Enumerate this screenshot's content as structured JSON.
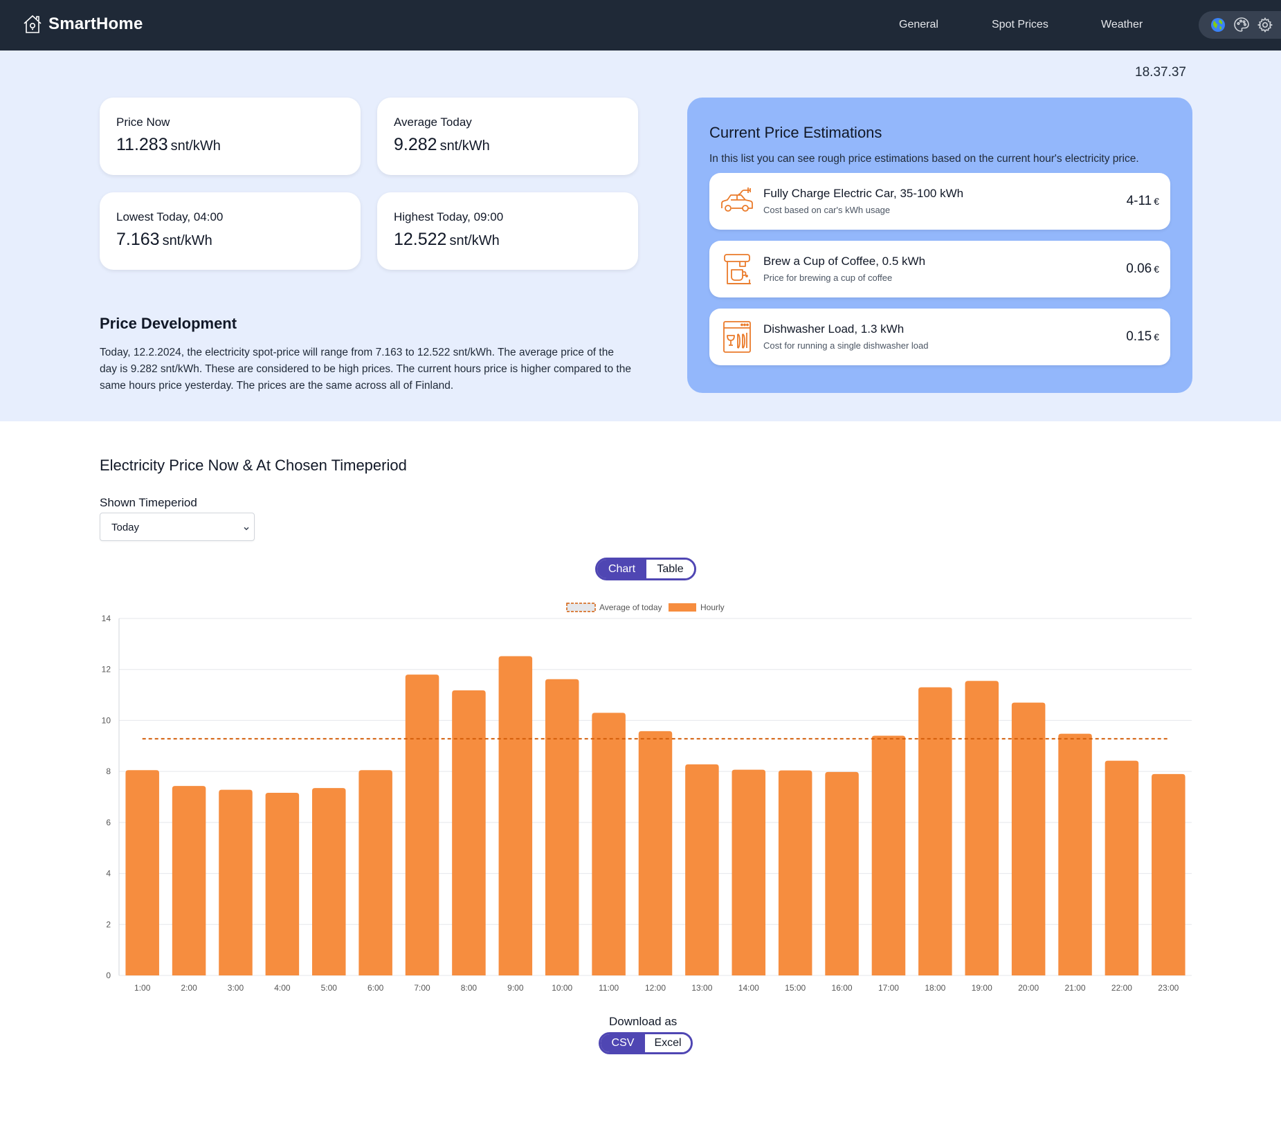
{
  "header": {
    "brand": "SmartHome",
    "nav": [
      {
        "label": "General"
      },
      {
        "label": "Spot Prices"
      },
      {
        "label": "Weather"
      }
    ],
    "icons": [
      "globe-icon",
      "palette-icon",
      "gear-icon"
    ]
  },
  "clock": "18.37.37",
  "stats": {
    "price_now": {
      "label": "Price Now",
      "value": "11.283",
      "unit": "snt/kWh"
    },
    "average_today": {
      "label": "Average Today",
      "value": "9.282",
      "unit": "snt/kWh"
    },
    "lowest_today": {
      "label": "Lowest Today, 04:00",
      "value": "7.163",
      "unit": "snt/kWh"
    },
    "highest_today": {
      "label": "Highest Today, 09:00",
      "value": "12.522",
      "unit": "snt/kWh"
    }
  },
  "development": {
    "title": "Price Development",
    "text": "Today, 12.2.2024, the electricity spot-price will range from 7.163 to 12.522 snt/kWh. The average price of the day is 9.282 snt/kWh. These are considered to be high prices. The current hours price is higher compared to the same hours price yesterday. The prices are the same across all of Finland."
  },
  "estimations": {
    "title": "Current Price Estimations",
    "description": "In this list you can see rough price estimations based on the current hour's electricity price.",
    "items": [
      {
        "name": "Fully Charge Electric Car, 35-100 kWh",
        "sub": "Cost based on car's kWh usage",
        "price": "4-11",
        "currency": "€",
        "icon": "electric-car-icon"
      },
      {
        "name": "Brew a Cup of Coffee, 0.5 kWh",
        "sub": "Price for brewing a cup of coffee",
        "price": "0.06",
        "currency": "€",
        "icon": "coffee-machine-icon"
      },
      {
        "name": "Dishwasher Load, 1.3 kWh",
        "sub": "Cost for running a single dishwasher load",
        "price": "0.15",
        "currency": "€",
        "icon": "dishwasher-icon"
      }
    ]
  },
  "chart_section": {
    "title": "Electricity Price Now & At Chosen Timeperiod",
    "period_label": "Shown Timeperiod",
    "period_value": "Today",
    "view_toggle": {
      "chart": "Chart",
      "table": "Table",
      "active": "Chart"
    },
    "download_label": "Download as",
    "download": {
      "csv": "CSV",
      "excel": "Excel",
      "active": "CSV"
    }
  },
  "colors": {
    "header_bg": "#1f2937",
    "top_bg": "#e7eefd",
    "panel_bg": "#93b7fb",
    "bar": "#f68d3f",
    "average_line": "#d35f0b",
    "accent": "#4f46b3",
    "icon_orange": "#ea7a2a"
  },
  "chart_data": {
    "type": "bar",
    "categories": [
      "1:00",
      "2:00",
      "3:00",
      "4:00",
      "5:00",
      "6:00",
      "7:00",
      "8:00",
      "9:00",
      "10:00",
      "11:00",
      "12:00",
      "13:00",
      "14:00",
      "15:00",
      "16:00",
      "17:00",
      "18:00",
      "19:00",
      "20:00",
      "21:00",
      "22:00",
      "23:00"
    ],
    "series": [
      {
        "name": "Hourly",
        "values": [
          8.05,
          7.43,
          7.28,
          7.163,
          7.35,
          8.05,
          11.8,
          11.18,
          12.522,
          11.62,
          10.3,
          9.58,
          8.28,
          8.07,
          8.04,
          7.98,
          9.4,
          11.3,
          11.55,
          10.7,
          9.48,
          8.42,
          7.9
        ]
      },
      {
        "name": "Average of today",
        "values": [
          9.282
        ]
      }
    ],
    "title": "",
    "xlabel": "",
    "ylabel": "",
    "ylim": [
      0,
      14
    ],
    "yticks": [
      0,
      2,
      4,
      6,
      8,
      10,
      12,
      14
    ],
    "grid": true,
    "legend": "top-center"
  }
}
